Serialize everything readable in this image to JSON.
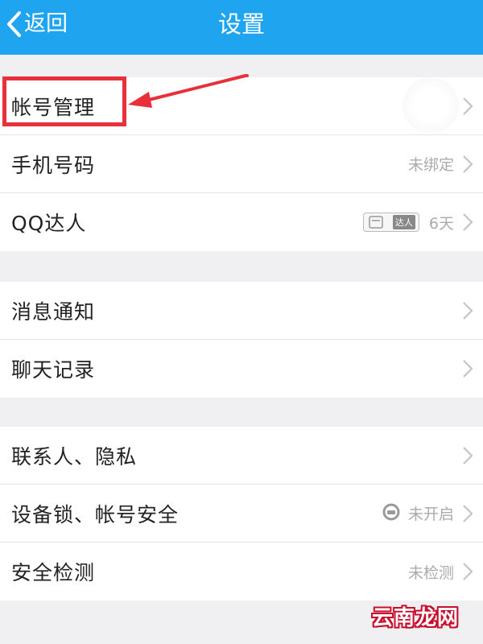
{
  "header": {
    "back_label": "返回",
    "title": "设置",
    "bg_color": "#1fa4ef"
  },
  "group1": [
    {
      "label": "帐号管理",
      "value": "",
      "icon": "chevron-right-icon"
    },
    {
      "label": "手机号码",
      "value": "未绑定",
      "icon": "chevron-right-icon"
    },
    {
      "label": "QQ达人",
      "value": "6天",
      "badge_text": "达人",
      "icon": "chevron-right-icon"
    }
  ],
  "group2": [
    {
      "label": "消息通知",
      "icon": "chevron-right-icon"
    },
    {
      "label": "聊天记录",
      "icon": "chevron-right-icon"
    }
  ],
  "group3": [
    {
      "label": "联系人、隐私",
      "icon": "chevron-right-icon"
    },
    {
      "label": "设备锁、帐号安全",
      "value": "未开启",
      "icon": "chevron-right-icon"
    },
    {
      "label": "安全检测",
      "value": "未检测",
      "icon": "chevron-right-icon"
    }
  ],
  "annotation": {
    "highlight_color": "#e8303a"
  },
  "watermark": "云南龙网"
}
